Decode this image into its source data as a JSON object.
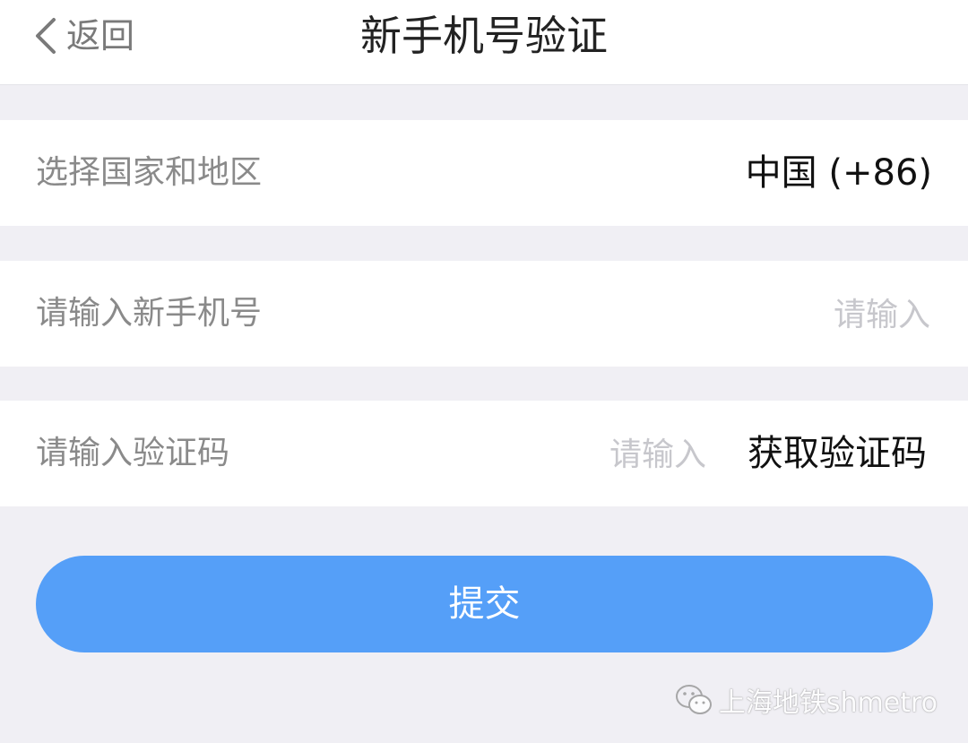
{
  "nav": {
    "back_label": "返回",
    "title": "新手机号验证"
  },
  "form": {
    "country": {
      "label": "选择国家和地区",
      "value": "中国 (+86)"
    },
    "phone": {
      "label": "请输入新手机号",
      "placeholder": "请输入",
      "value": ""
    },
    "code": {
      "label": "请输入验证码",
      "placeholder": "请输入",
      "value": "",
      "get_code_label": "获取验证码"
    },
    "submit_label": "提交"
  },
  "watermark": {
    "text": "上海地铁shmetro",
    "icon": "wechat-icon"
  },
  "colors": {
    "background": "#f0eff4",
    "accent": "#559ff8",
    "placeholder": "#c7c7cc"
  }
}
